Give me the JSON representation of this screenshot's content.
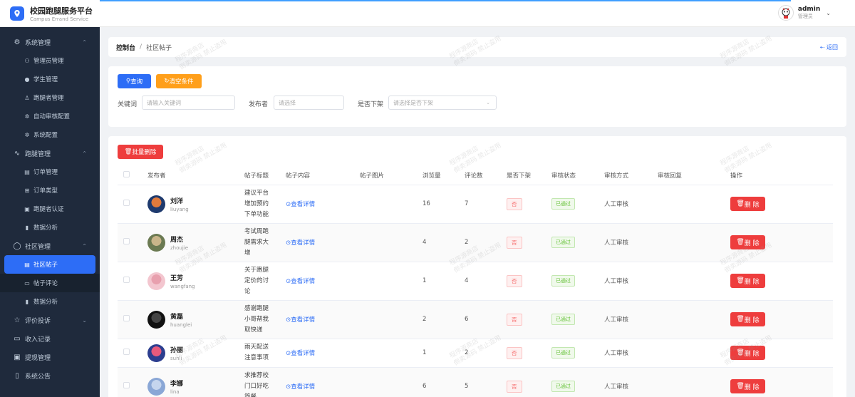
{
  "app": {
    "title": "校园跑腿服务平台",
    "subtitle": "Campus Errand Service"
  },
  "user": {
    "name": "admin",
    "role": "管理员"
  },
  "sidebar": {
    "groups": [
      {
        "label": "系统管理",
        "items": [
          "管理员管理",
          "学生管理",
          "跑腿者管理",
          "自动审核配置",
          "系统配置"
        ]
      },
      {
        "label": "跑腿管理",
        "items": [
          "订单管理",
          "订单类型",
          "跑腿者认证",
          "数据分析"
        ]
      },
      {
        "label": "社区管理",
        "items": [
          "社区帖子",
          "帖子评论",
          "数据分析"
        ]
      },
      {
        "label": "评价投诉"
      },
      {
        "label": "收入记录"
      },
      {
        "label": "提现管理"
      },
      {
        "label": "系统公告"
      }
    ]
  },
  "breadcrumb": {
    "home": "控制台",
    "current": "社区帖子",
    "back": "返回"
  },
  "filter": {
    "query_btn": "查询",
    "clear_btn": "清空条件",
    "keyword_label": "关键词",
    "keyword_placeholder": "请输入关键词",
    "publisher_label": "发布者",
    "publisher_placeholder": "请选择",
    "status_label": "是否下架",
    "status_placeholder": "请选择是否下架"
  },
  "table": {
    "batch_delete": "批量删除",
    "columns": [
      "发布者",
      "帖子标题",
      "帖子内容",
      "帖子图片",
      "浏览量",
      "评论数",
      "是否下架",
      "审核状态",
      "审核方式",
      "审核回复",
      "操作"
    ],
    "view_label": "查看详情",
    "delete_label": "删 除",
    "rows": [
      {
        "name": "刘洋",
        "username": "liuyang",
        "title": "建议平台增加预约下单功能",
        "views": "16",
        "comments": "7",
        "offline": "否",
        "audit": "已通过",
        "method": "人工审核",
        "reply": ""
      },
      {
        "name": "周杰",
        "username": "zhoujie",
        "title": "考试周跑腿需求大增",
        "views": "4",
        "comments": "2",
        "offline": "否",
        "audit": "已通过",
        "method": "人工审核",
        "reply": ""
      },
      {
        "name": "王芳",
        "username": "wangfang",
        "title": "关于跑腿定价的讨论",
        "views": "1",
        "comments": "4",
        "offline": "否",
        "audit": "已通过",
        "method": "人工审核",
        "reply": ""
      },
      {
        "name": "黄磊",
        "username": "huanglei",
        "title": "感谢跑腿小哥帮我取快递",
        "views": "2",
        "comments": "6",
        "offline": "否",
        "audit": "已通过",
        "method": "人工审核",
        "reply": ""
      },
      {
        "name": "孙丽",
        "username": "sunli",
        "title": "雨天配送注意事项",
        "views": "1",
        "comments": "2",
        "offline": "否",
        "audit": "已通过",
        "method": "人工审核",
        "reply": ""
      },
      {
        "name": "李娜",
        "username": "lina",
        "title": "求推荐校门口好吃简餐",
        "views": "6",
        "comments": "5",
        "offline": "否",
        "audit": "已通过",
        "method": "人工审核",
        "reply": ""
      }
    ]
  },
  "watermark": {
    "line1": "程序源商店",
    "line2": "倒卖源码 禁止盗用"
  },
  "colors": {
    "primary": "#2d6df6",
    "danger": "#ee3d3d",
    "warning": "#ff9f1a",
    "sidebar_bg": "#1f2a3c"
  }
}
